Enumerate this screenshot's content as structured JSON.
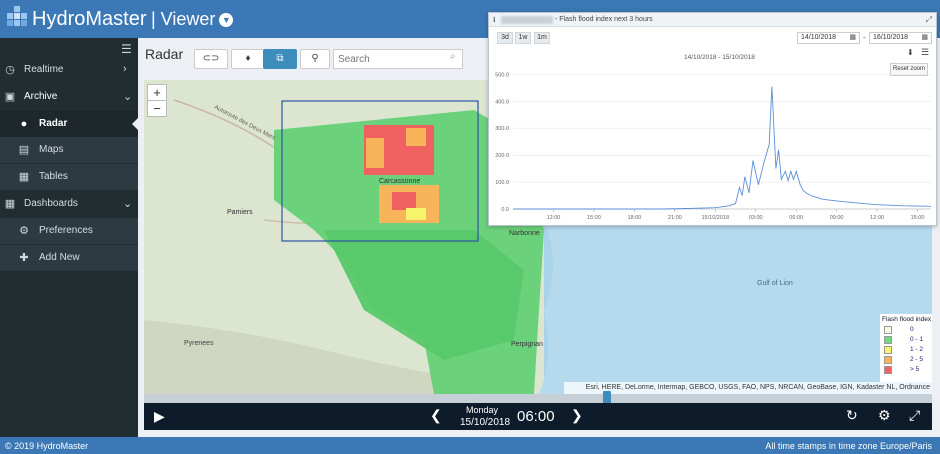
{
  "header": {
    "brand": "HydroMaster",
    "section": "| Viewer"
  },
  "sidebar": {
    "items": [
      {
        "label": "Realtime",
        "icon": "clock-icon"
      },
      {
        "label": "Archive",
        "icon": "archive-icon"
      },
      {
        "label": "Radar",
        "icon": "globe-icon"
      },
      {
        "label": "Maps",
        "icon": "map-icon"
      },
      {
        "label": "Tables",
        "icon": "table-icon"
      },
      {
        "label": "Dashboards",
        "icon": "grid-icon"
      },
      {
        "label": "Preferences",
        "icon": "gear-icon"
      },
      {
        "label": "Add New",
        "icon": "plus-icon"
      }
    ]
  },
  "page": {
    "title": "Radar"
  },
  "search": {
    "placeholder": "Search"
  },
  "map": {
    "attribution": "Esri, HERE, DeLorme, Intermap, GEBCO, USGS, FAO, NPS, NRCAN, GeoBase, IGN, Kadaster NL, Ordnance Survey",
    "places": [
      "Carcassonne",
      "Pamiers",
      "Narbonne",
      "Gulf of Lion",
      "Perpignan",
      "Pyrenees",
      "Autoroute des Deux Mers"
    ],
    "legend": {
      "title": "Flash flood index",
      "entries": [
        {
          "label": "0",
          "color": "#f4fbe6"
        },
        {
          "label": "0 - 1",
          "color": "#6fd97c"
        },
        {
          "label": "1 - 2",
          "color": "#f7f36a"
        },
        {
          "label": "2 - 5",
          "color": "#f7b45a"
        },
        {
          "label": "> 5",
          "color": "#f06262"
        }
      ]
    }
  },
  "playback": {
    "day": "Monday",
    "date": "15/10/2018",
    "time": "06:00",
    "slider_position": 0.58
  },
  "footer": {
    "copyright": "© 2019 HydroMaster",
    "timezone": "All time stamps in time zone Europe/Paris"
  },
  "popup": {
    "title": "- Flash flood index next 3 hours",
    "ranges": [
      "3d",
      "1w",
      "1m"
    ],
    "date_from": "14/10/2018",
    "date_to": "16/10/2018",
    "reset_zoom": "Reset zoom"
  },
  "chart_data": {
    "type": "line",
    "title": "14/10/2018 - 15/10/2018",
    "x_tick_labels": [
      "12:00",
      "15:00",
      "18:00",
      "21:00",
      "15/10/2018",
      "03:00",
      "06:00",
      "09:00",
      "12:00",
      "15:00"
    ],
    "y_tick_labels": [
      "0.0",
      "100.0",
      "200.0",
      "300.0",
      "400.0",
      "500.0"
    ],
    "ylim": [
      0,
      520
    ],
    "xlim_hours": [
      9,
      40
    ],
    "grid": true,
    "series": [
      {
        "color": "#5b8fd6",
        "x_hours": [
          9,
          20,
          22,
          24,
          25,
          25.5,
          25.8,
          26,
          26.2,
          26.5,
          26.8,
          27.2,
          27.6,
          28,
          28.2,
          28.5,
          28.7,
          28.9,
          29.2,
          29.4,
          29.6,
          29.8,
          30,
          30.3,
          30.5,
          30.8,
          31.2,
          31.6,
          32,
          33,
          34,
          35,
          36,
          38,
          40
        ],
        "values": [
          0,
          0,
          2,
          5,
          12,
          20,
          80,
          50,
          120,
          60,
          180,
          90,
          170,
          240,
          455,
          150,
          220,
          110,
          140,
          105,
          140,
          110,
          140,
          90,
          70,
          58,
          48,
          42,
          36,
          30,
          25,
          20,
          16,
          12,
          10
        ]
      }
    ]
  }
}
